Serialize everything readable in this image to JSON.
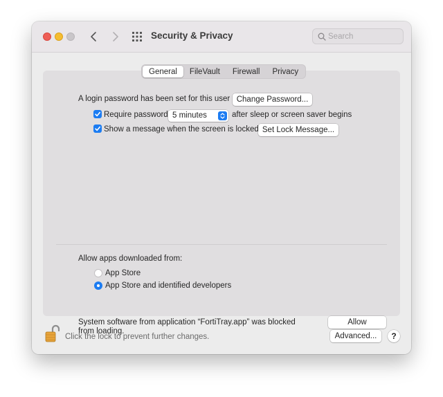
{
  "window": {
    "title": "Security & Privacy"
  },
  "search": {
    "placeholder": "Search"
  },
  "tabs": [
    {
      "label": "General",
      "active": true
    },
    {
      "label": "FileVault",
      "active": false
    },
    {
      "label": "Firewall",
      "active": false
    },
    {
      "label": "Privacy",
      "active": false
    }
  ],
  "general": {
    "login_text": "A login password has been set for this user",
    "change_password_label": "Change Password...",
    "require_password": {
      "checked": true,
      "label": "Require password",
      "value": "5 minutes",
      "suffix": "after sleep or screen saver begins"
    },
    "show_message": {
      "checked": true,
      "label": "Show a message when the screen is locked",
      "button": "Set Lock Message..."
    }
  },
  "downloads": {
    "heading": "Allow apps downloaded from:",
    "options": [
      {
        "label": "App Store",
        "selected": false
      },
      {
        "label": "App Store and identified developers",
        "selected": true
      }
    ]
  },
  "blocked": {
    "line1": "System software from application “FortiTray.app” was blocked",
    "line2": "from loading.",
    "allow_label": "Allow"
  },
  "footer": {
    "lock_text": "Click the lock to prevent further changes.",
    "advanced_label": "Advanced...",
    "help_label": "?"
  },
  "colors": {
    "accent": "#1c7cf2",
    "close": "#ee5f57",
    "minimize": "#f5bd31"
  },
  "icons": [
    "chevron-left-icon",
    "chevron-right-icon",
    "grid-icon",
    "search-icon",
    "checkmark-icon",
    "stepper-icon",
    "padlock-icon"
  ]
}
